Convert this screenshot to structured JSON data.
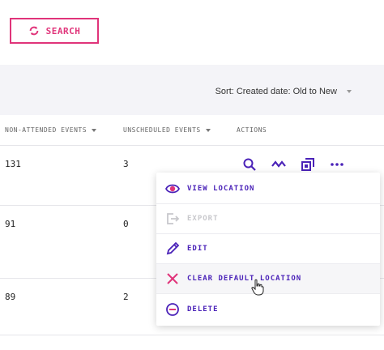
{
  "search_button": {
    "label": "SEARCH"
  },
  "toolbar": {
    "sort_label": "Sort: Created date: Old to New"
  },
  "table": {
    "headers": [
      "NON-ATTENDED EVENTS",
      "UNSCHEDULED EVENTS",
      "ACTIONS"
    ],
    "rows": [
      {
        "non_attended": "131",
        "unscheduled": "3"
      },
      {
        "non_attended": "91",
        "unscheduled": "0"
      },
      {
        "non_attended": "89",
        "unscheduled": "2"
      }
    ]
  },
  "actions": {
    "icons": [
      "search-icon",
      "activity-icon",
      "resize-icon",
      "more-icon"
    ]
  },
  "menu": {
    "items": [
      {
        "label": "VIEW LOCATION",
        "icon": "eye-icon",
        "disabled": false
      },
      {
        "label": "EXPORT",
        "icon": "export-icon",
        "disabled": true
      },
      {
        "label": "EDIT",
        "icon": "pencil-icon",
        "disabled": false
      },
      {
        "label": "CLEAR DEFAULT LOCATION",
        "icon": "x-icon",
        "disabled": false
      },
      {
        "label": "DELETE",
        "icon": "minus-circle-icon",
        "disabled": false
      }
    ]
  },
  "colors": {
    "accent_pink": "#e0347a",
    "accent_purple": "#4a22b8",
    "danger": "#e0347a"
  }
}
